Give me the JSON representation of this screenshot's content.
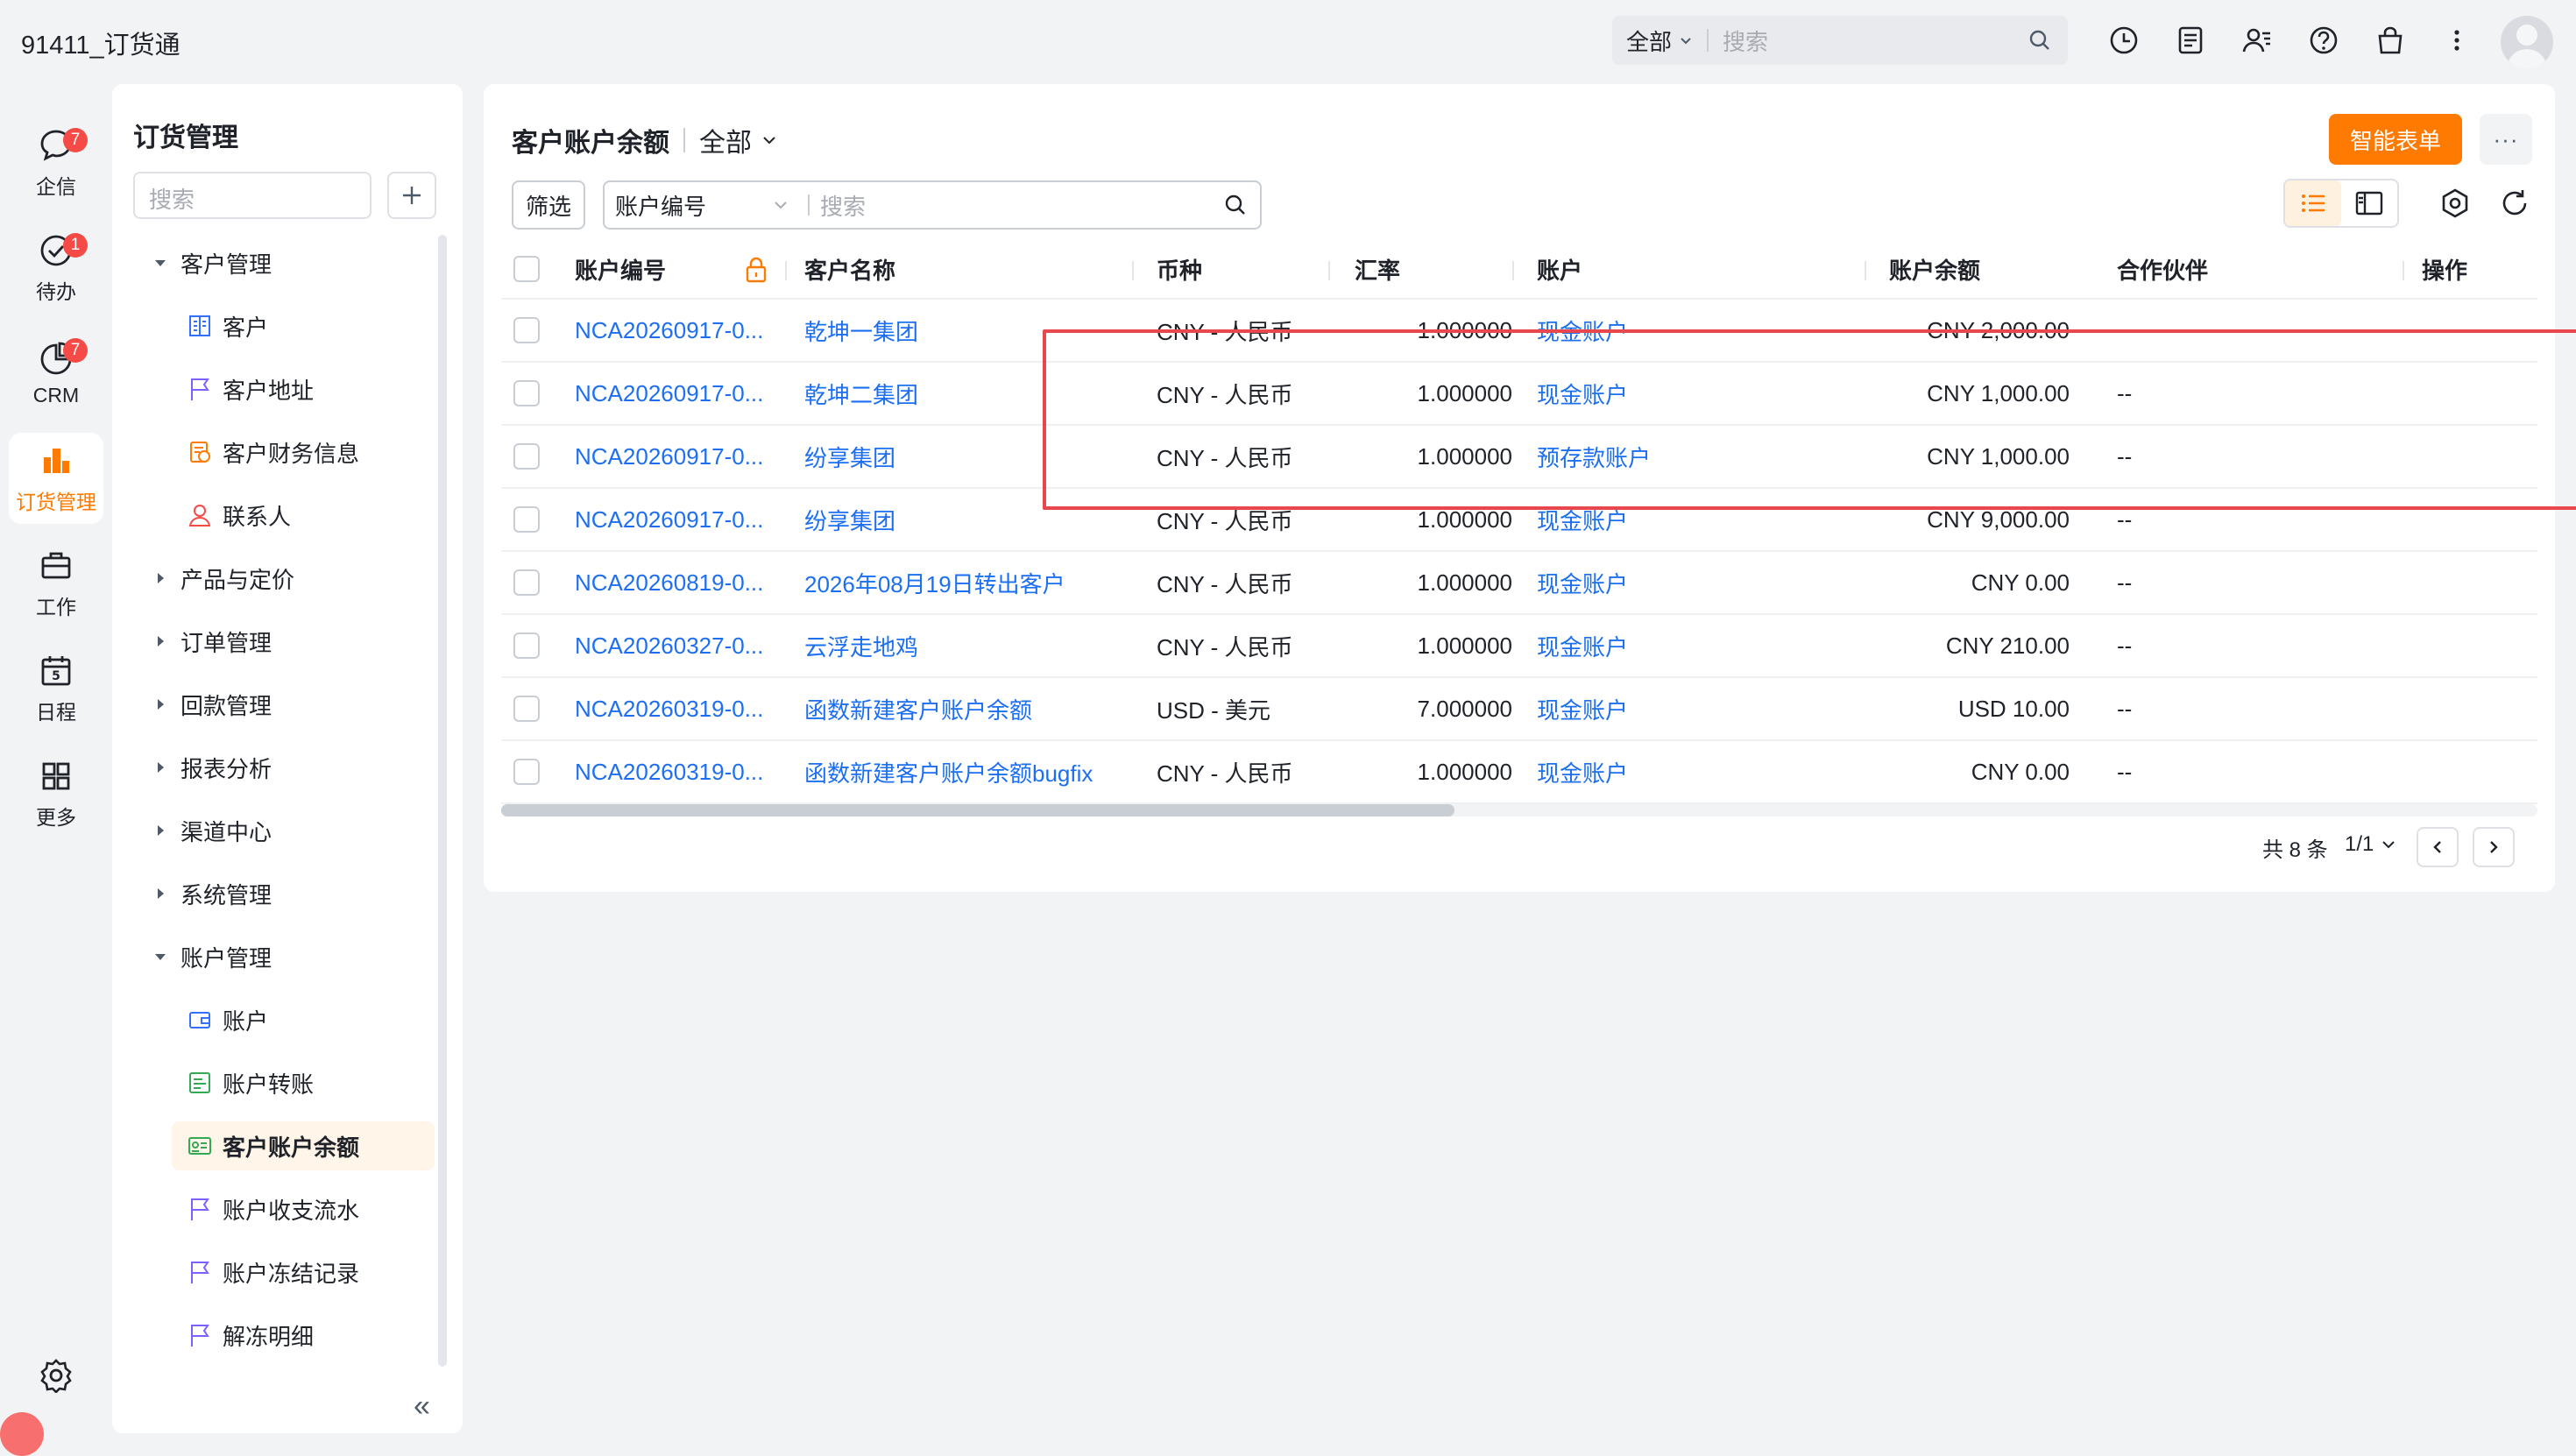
{
  "app": {
    "title": "91411_订货通"
  },
  "global_search": {
    "scope": "全部",
    "placeholder": "搜索"
  },
  "topbar_icons": [
    "clock-icon",
    "notes-icon",
    "contacts-icon",
    "help-icon",
    "bag-icon",
    "more-vertical-icon"
  ],
  "rail": {
    "items": [
      {
        "label": "企信",
        "badge": "7",
        "icon": "chat-icon"
      },
      {
        "label": "待办",
        "badge": "1",
        "icon": "todo-icon"
      },
      {
        "label": "CRM",
        "badge": "7",
        "icon": "crm-icon"
      },
      {
        "label": "订货管理",
        "badge": "",
        "icon": "order-icon",
        "active": true
      },
      {
        "label": "工作",
        "badge": "",
        "icon": "briefcase-icon"
      },
      {
        "label": "日程",
        "badge": "",
        "icon": "calendar-icon"
      },
      {
        "label": "更多",
        "badge": "",
        "icon": "grid-icon"
      }
    ],
    "calendar_day": "5"
  },
  "nav": {
    "title": "订货管理",
    "search_placeholder": "搜索",
    "groups": [
      {
        "label": "客户管理",
        "expanded": true
      },
      {
        "label": "产品与定价",
        "expanded": false
      },
      {
        "label": "订单管理",
        "expanded": false
      },
      {
        "label": "回款管理",
        "expanded": false
      },
      {
        "label": "报表分析",
        "expanded": false
      },
      {
        "label": "渠道中心",
        "expanded": false
      },
      {
        "label": "系统管理",
        "expanded": false
      },
      {
        "label": "账户管理",
        "expanded": true
      }
    ],
    "customer_items": [
      "客户",
      "客户地址",
      "客户财务信息",
      "联系人"
    ],
    "account_items": [
      "账户",
      "账户转账",
      "客户账户余额",
      "账户收支流水",
      "账户冻结记录",
      "解冻明细"
    ],
    "active_item": "客户账户余额",
    "collapse_label": "«"
  },
  "main": {
    "title": "客户账户余额",
    "view": "全部",
    "smart_form_label": "智能表单",
    "more_label": "···",
    "filter_label": "筛选",
    "search_field": "账户编号",
    "search_placeholder": "搜索",
    "columns": [
      "账户编号",
      "客户名称",
      "币种",
      "汇率",
      "账户",
      "账户余额",
      "合作伙伴",
      "操作"
    ],
    "rows": [
      {
        "account_no": "NCA20260917-0...",
        "customer": "乾坤一集团",
        "currency": "CNY - 人民币",
        "rate": "1.000000",
        "account": "现金账户",
        "balance": "CNY 2,000.00",
        "partner": "--"
      },
      {
        "account_no": "NCA20260917-0...",
        "customer": "乾坤二集团",
        "currency": "CNY - 人民币",
        "rate": "1.000000",
        "account": "现金账户",
        "balance": "CNY 1,000.00",
        "partner": "--"
      },
      {
        "account_no": "NCA20260917-0...",
        "customer": "纷享集团",
        "currency": "CNY - 人民币",
        "rate": "1.000000",
        "account": "预存款账户",
        "balance": "CNY 1,000.00",
        "partner": "--"
      },
      {
        "account_no": "NCA20260917-0...",
        "customer": "纷享集团",
        "currency": "CNY - 人民币",
        "rate": "1.000000",
        "account": "现金账户",
        "balance": "CNY 9,000.00",
        "partner": "--"
      },
      {
        "account_no": "NCA20260819-0...",
        "customer": "2026年08月19日转出客户",
        "currency": "CNY - 人民币",
        "rate": "1.000000",
        "account": "现金账户",
        "balance": "CNY 0.00",
        "partner": "--"
      },
      {
        "account_no": "NCA20260327-0...",
        "customer": "云浮走地鸡",
        "currency": "CNY - 人民币",
        "rate": "1.000000",
        "account": "现金账户",
        "balance": "CNY 210.00",
        "partner": "--"
      },
      {
        "account_no": "NCA20260319-0...",
        "customer": "函数新建客户账户余额",
        "currency": "USD - 美元",
        "rate": "7.000000",
        "account": "现金账户",
        "balance": "USD 10.00",
        "partner": "--"
      },
      {
        "account_no": "NCA20260319-0...",
        "customer": "函数新建客户账户余额bugfix",
        "currency": "CNY - 人民币",
        "rate": "1.000000",
        "account": "现金账户",
        "balance": "CNY 0.00",
        "partner": "--"
      }
    ],
    "pager": {
      "total": "共 8 条",
      "page": "1/1"
    }
  },
  "colors": {
    "accent": "#ff7a00",
    "link": "#1d6ff2",
    "highlight": "#e8474d",
    "badge": "#f54a45"
  }
}
